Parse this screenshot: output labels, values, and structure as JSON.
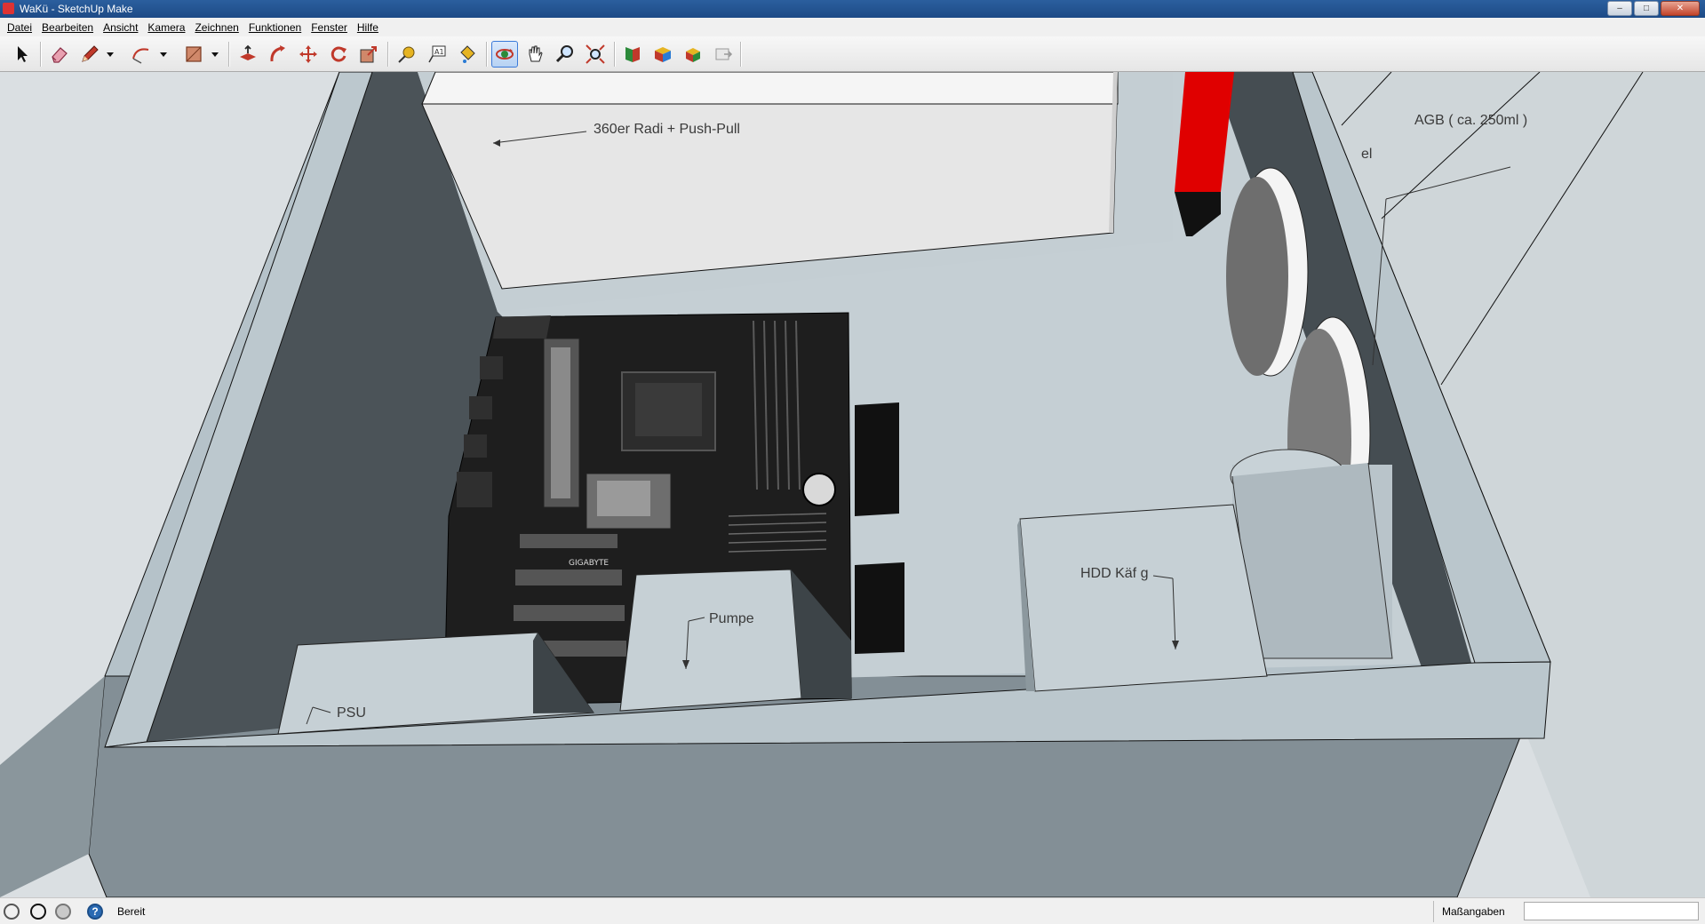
{
  "window": {
    "title": "WaKü - SketchUp Make"
  },
  "menubar": {
    "items": [
      "Datei",
      "Bearbeiten",
      "Ansicht",
      "Kamera",
      "Zeichnen",
      "Funktionen",
      "Fenster",
      "Hilfe"
    ]
  },
  "toolbar": {
    "tools": [
      "select-icon",
      "eraser-icon",
      "pencil-icon",
      "arc-icon",
      "rectangle-icon",
      "push-pull-icon",
      "follow-me-icon",
      "move-icon",
      "rotate-icon",
      "scale-icon",
      "tape-measure-icon",
      "text-icon",
      "paint-bucket-icon",
      "orbit-icon",
      "pan-icon",
      "zoom-icon",
      "zoom-extents-icon",
      "3d-warehouse-icon",
      "share-model-icon",
      "components-icon",
      "extension-icon"
    ],
    "active_tool": "orbit-icon"
  },
  "scene": {
    "labels": {
      "radiator": "360er Radi + Push-Pull",
      "reservoir": "AGB ( ca. 250ml )",
      "partial": "el",
      "pump": "Pumpe",
      "hdd": "HDD Käf g",
      "psu": "PSU"
    },
    "colors": {
      "background": "#dadfe2",
      "case_light": "#bcc8ce",
      "case_dark": "#4a5156",
      "accent_red": "#e60000",
      "board": "#1e1e1e"
    }
  },
  "statusbar": {
    "status_text": "Bereit",
    "measurements_label": "Maßangaben",
    "measurements_value": ""
  }
}
